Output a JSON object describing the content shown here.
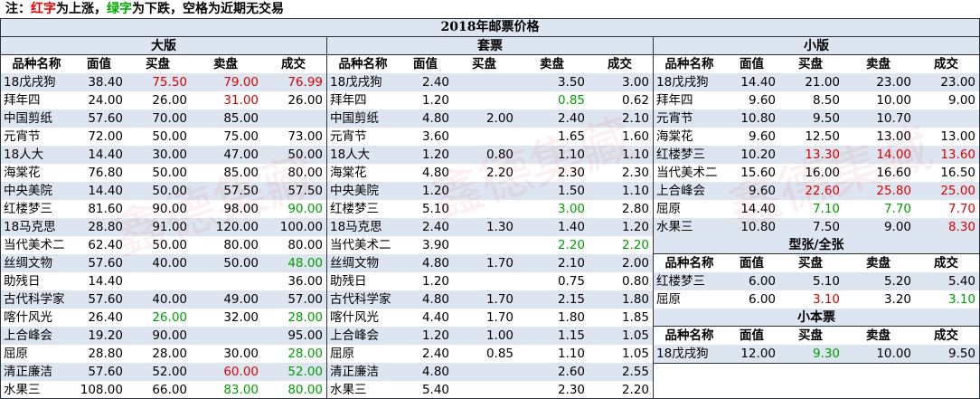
{
  "note": {
    "prefix": "注：",
    "red_word": "红字",
    "mid1": "为上涨，",
    "green_word": "绿字",
    "mid2": "为下跌，空格为近期无交易"
  },
  "title": "2018年邮票价格",
  "headers": {
    "name": "品种名称",
    "face": "面值",
    "buy": "买盘",
    "sell": "卖盘",
    "deal": "成交"
  },
  "panels": {
    "large": {
      "title": "大版",
      "rows": [
        [
          "18戊戌狗",
          "38.40",
          "75.50",
          "79.00",
          "76.99",
          "n",
          "r",
          "r",
          "r"
        ],
        [
          "拜年四",
          "24.00",
          "26.00",
          "31.00",
          "26.00",
          "n",
          "n",
          "r",
          "n"
        ],
        [
          "中国剪纸",
          "57.60",
          "70.00",
          "85.00",
          "",
          "n",
          "n",
          "n",
          "n"
        ],
        [
          "元宵节",
          "72.00",
          "50.00",
          "75.00",
          "73.00",
          "n",
          "n",
          "n",
          "n"
        ],
        [
          "18人大",
          "14.40",
          "30.00",
          "47.00",
          "50.00",
          "n",
          "n",
          "n",
          "n"
        ],
        [
          "海棠花",
          "76.80",
          "50.00",
          "85.00",
          "80.00",
          "n",
          "n",
          "n",
          "n"
        ],
        [
          "中央美院",
          "14.40",
          "50.00",
          "57.50",
          "57.50",
          "n",
          "n",
          "n",
          "n"
        ],
        [
          "红楼梦三",
          "81.60",
          "90.00",
          "98.00",
          "90.00",
          "n",
          "n",
          "n",
          "g"
        ],
        [
          "18马克思",
          "28.80",
          "91.00",
          "120.00",
          "100.00",
          "n",
          "n",
          "n",
          "n"
        ],
        [
          "当代美术二",
          "62.40",
          "50.00",
          "80.00",
          "80.00",
          "n",
          "n",
          "n",
          "n"
        ],
        [
          "丝绸文物",
          "57.60",
          "40.00",
          "50.00",
          "48.00",
          "n",
          "n",
          "n",
          "g"
        ],
        [
          "助残日",
          "14.40",
          "",
          "",
          "36.00",
          "n",
          "n",
          "n",
          "n"
        ],
        [
          "古代科学家",
          "57.60",
          "40.00",
          "49.00",
          "57.00",
          "n",
          "n",
          "n",
          "n"
        ],
        [
          "喀什风光",
          "26.40",
          "26.00",
          "32.00",
          "28.00",
          "n",
          "g",
          "n",
          "g"
        ],
        [
          "上合峰会",
          "19.20",
          "90.00",
          "",
          "95.00",
          "n",
          "n",
          "n",
          "n"
        ],
        [
          "屈原",
          "28.80",
          "28.00",
          "30.00",
          "28.00",
          "n",
          "n",
          "n",
          "g"
        ],
        [
          "清正廉洁",
          "57.60",
          "52.00",
          "60.00",
          "52.00",
          "n",
          "n",
          "r",
          "g"
        ],
        [
          "水果三",
          "108.00",
          "66.00",
          "83.00",
          "80.00",
          "n",
          "n",
          "g",
          "g"
        ]
      ]
    },
    "set": {
      "title": "套票",
      "rows": [
        [
          "18戊戌狗",
          "2.40",
          "",
          "3.50",
          "3.00",
          "n",
          "n",
          "n",
          "n"
        ],
        [
          "拜年四",
          "1.20",
          "",
          "0.85",
          "0.62",
          "n",
          "n",
          "g",
          "n"
        ],
        [
          "中国剪纸",
          "4.80",
          "2.00",
          "2.40",
          "2.10",
          "n",
          "n",
          "n",
          "n"
        ],
        [
          "元宵节",
          "3.60",
          "",
          "1.65",
          "1.60",
          "n",
          "n",
          "n",
          "n"
        ],
        [
          "18人大",
          "1.20",
          "0.80",
          "1.10",
          "1.10",
          "n",
          "n",
          "n",
          "n"
        ],
        [
          "海棠花",
          "4.80",
          "2.20",
          "2.30",
          "2.30",
          "n",
          "n",
          "n",
          "n"
        ],
        [
          "中央美院",
          "1.20",
          "",
          "1.50",
          "1.10",
          "n",
          "n",
          "n",
          "n"
        ],
        [
          "红楼梦三",
          "5.10",
          "",
          "3.00",
          "2.80",
          "n",
          "n",
          "g",
          "n"
        ],
        [
          "18马克思",
          "2.40",
          "1.30",
          "1.40",
          "1.20",
          "n",
          "n",
          "n",
          "n"
        ],
        [
          "当代美术二",
          "3.90",
          "",
          "2.20",
          "2.20",
          "n",
          "n",
          "g",
          "g"
        ],
        [
          "丝绸文物",
          "4.80",
          "1.70",
          "2.10",
          "2.00",
          "n",
          "n",
          "n",
          "n"
        ],
        [
          "助残日",
          "1.20",
          "",
          "0.75",
          "0.80",
          "n",
          "n",
          "n",
          "n"
        ],
        [
          "古代科学家",
          "4.80",
          "1.70",
          "2.15",
          "1.80",
          "n",
          "n",
          "n",
          "n"
        ],
        [
          "喀什风光",
          "4.40",
          "1.70",
          "1.80",
          "1.85",
          "n",
          "n",
          "n",
          "n"
        ],
        [
          "上合峰会",
          "1.20",
          "1.00",
          "1.15",
          "1.05",
          "n",
          "n",
          "n",
          "n"
        ],
        [
          "屈原",
          "2.40",
          "0.85",
          "1.10",
          "1.05",
          "n",
          "n",
          "n",
          "n"
        ],
        [
          "清正廉洁",
          "4.80",
          "",
          "2.60",
          "2.55",
          "n",
          "n",
          "n",
          "n"
        ],
        [
          "水果三",
          "5.40",
          "",
          "2.30",
          "2.20",
          "n",
          "n",
          "n",
          "n"
        ]
      ]
    },
    "small": {
      "title": "小版",
      "rows": [
        [
          "18戊戌狗",
          "14.40",
          "21.00",
          "23.00",
          "23.00",
          "n",
          "n",
          "n",
          "n"
        ],
        [
          "拜年四",
          "9.60",
          "8.50",
          "10.00",
          "9.00",
          "n",
          "n",
          "n",
          "n"
        ],
        [
          "元宵节",
          "10.80",
          "9.50",
          "10.70",
          "",
          "n",
          "n",
          "n",
          "n"
        ],
        [
          "海棠花",
          "9.60",
          "12.50",
          "13.00",
          "13.00",
          "n",
          "n",
          "n",
          "n"
        ],
        [
          "红楼梦三",
          "10.20",
          "13.30",
          "14.00",
          "13.60",
          "n",
          "r",
          "r",
          "r"
        ],
        [
          "当代美术二",
          "15.60",
          "16.00",
          "16.60",
          "16.50",
          "n",
          "n",
          "n",
          "n"
        ],
        [
          "上合峰会",
          "9.60",
          "22.60",
          "25.80",
          "25.00",
          "n",
          "r",
          "r",
          "r"
        ],
        [
          "屈原",
          "14.40",
          "7.10",
          "7.70",
          "7.70",
          "n",
          "g",
          "g",
          "r"
        ],
        [
          "水果三",
          "10.80",
          "7.50",
          "9.00",
          "8.30",
          "n",
          "n",
          "n",
          "r"
        ]
      ]
    },
    "sheet": {
      "title": "型张/全张",
      "rows": [
        [
          "红楼梦三",
          "6.00",
          "5.10",
          "5.20",
          "5.40",
          "n",
          "n",
          "n",
          "n"
        ],
        [
          "屈原",
          "6.00",
          "3.10",
          "3.20",
          "3.10",
          "n",
          "r",
          "n",
          "g"
        ]
      ]
    },
    "booklet": {
      "title": "小本票",
      "rows": [
        [
          "18戊戌狗",
          "12.00",
          "9.30",
          "10.00",
          "9.50",
          "n",
          "g",
          "n",
          "n"
        ]
      ]
    }
  },
  "watermark": "鑫德集藏",
  "colors": {
    "red": "#e00000",
    "green": "#00a000",
    "band": "#dde5f0"
  }
}
